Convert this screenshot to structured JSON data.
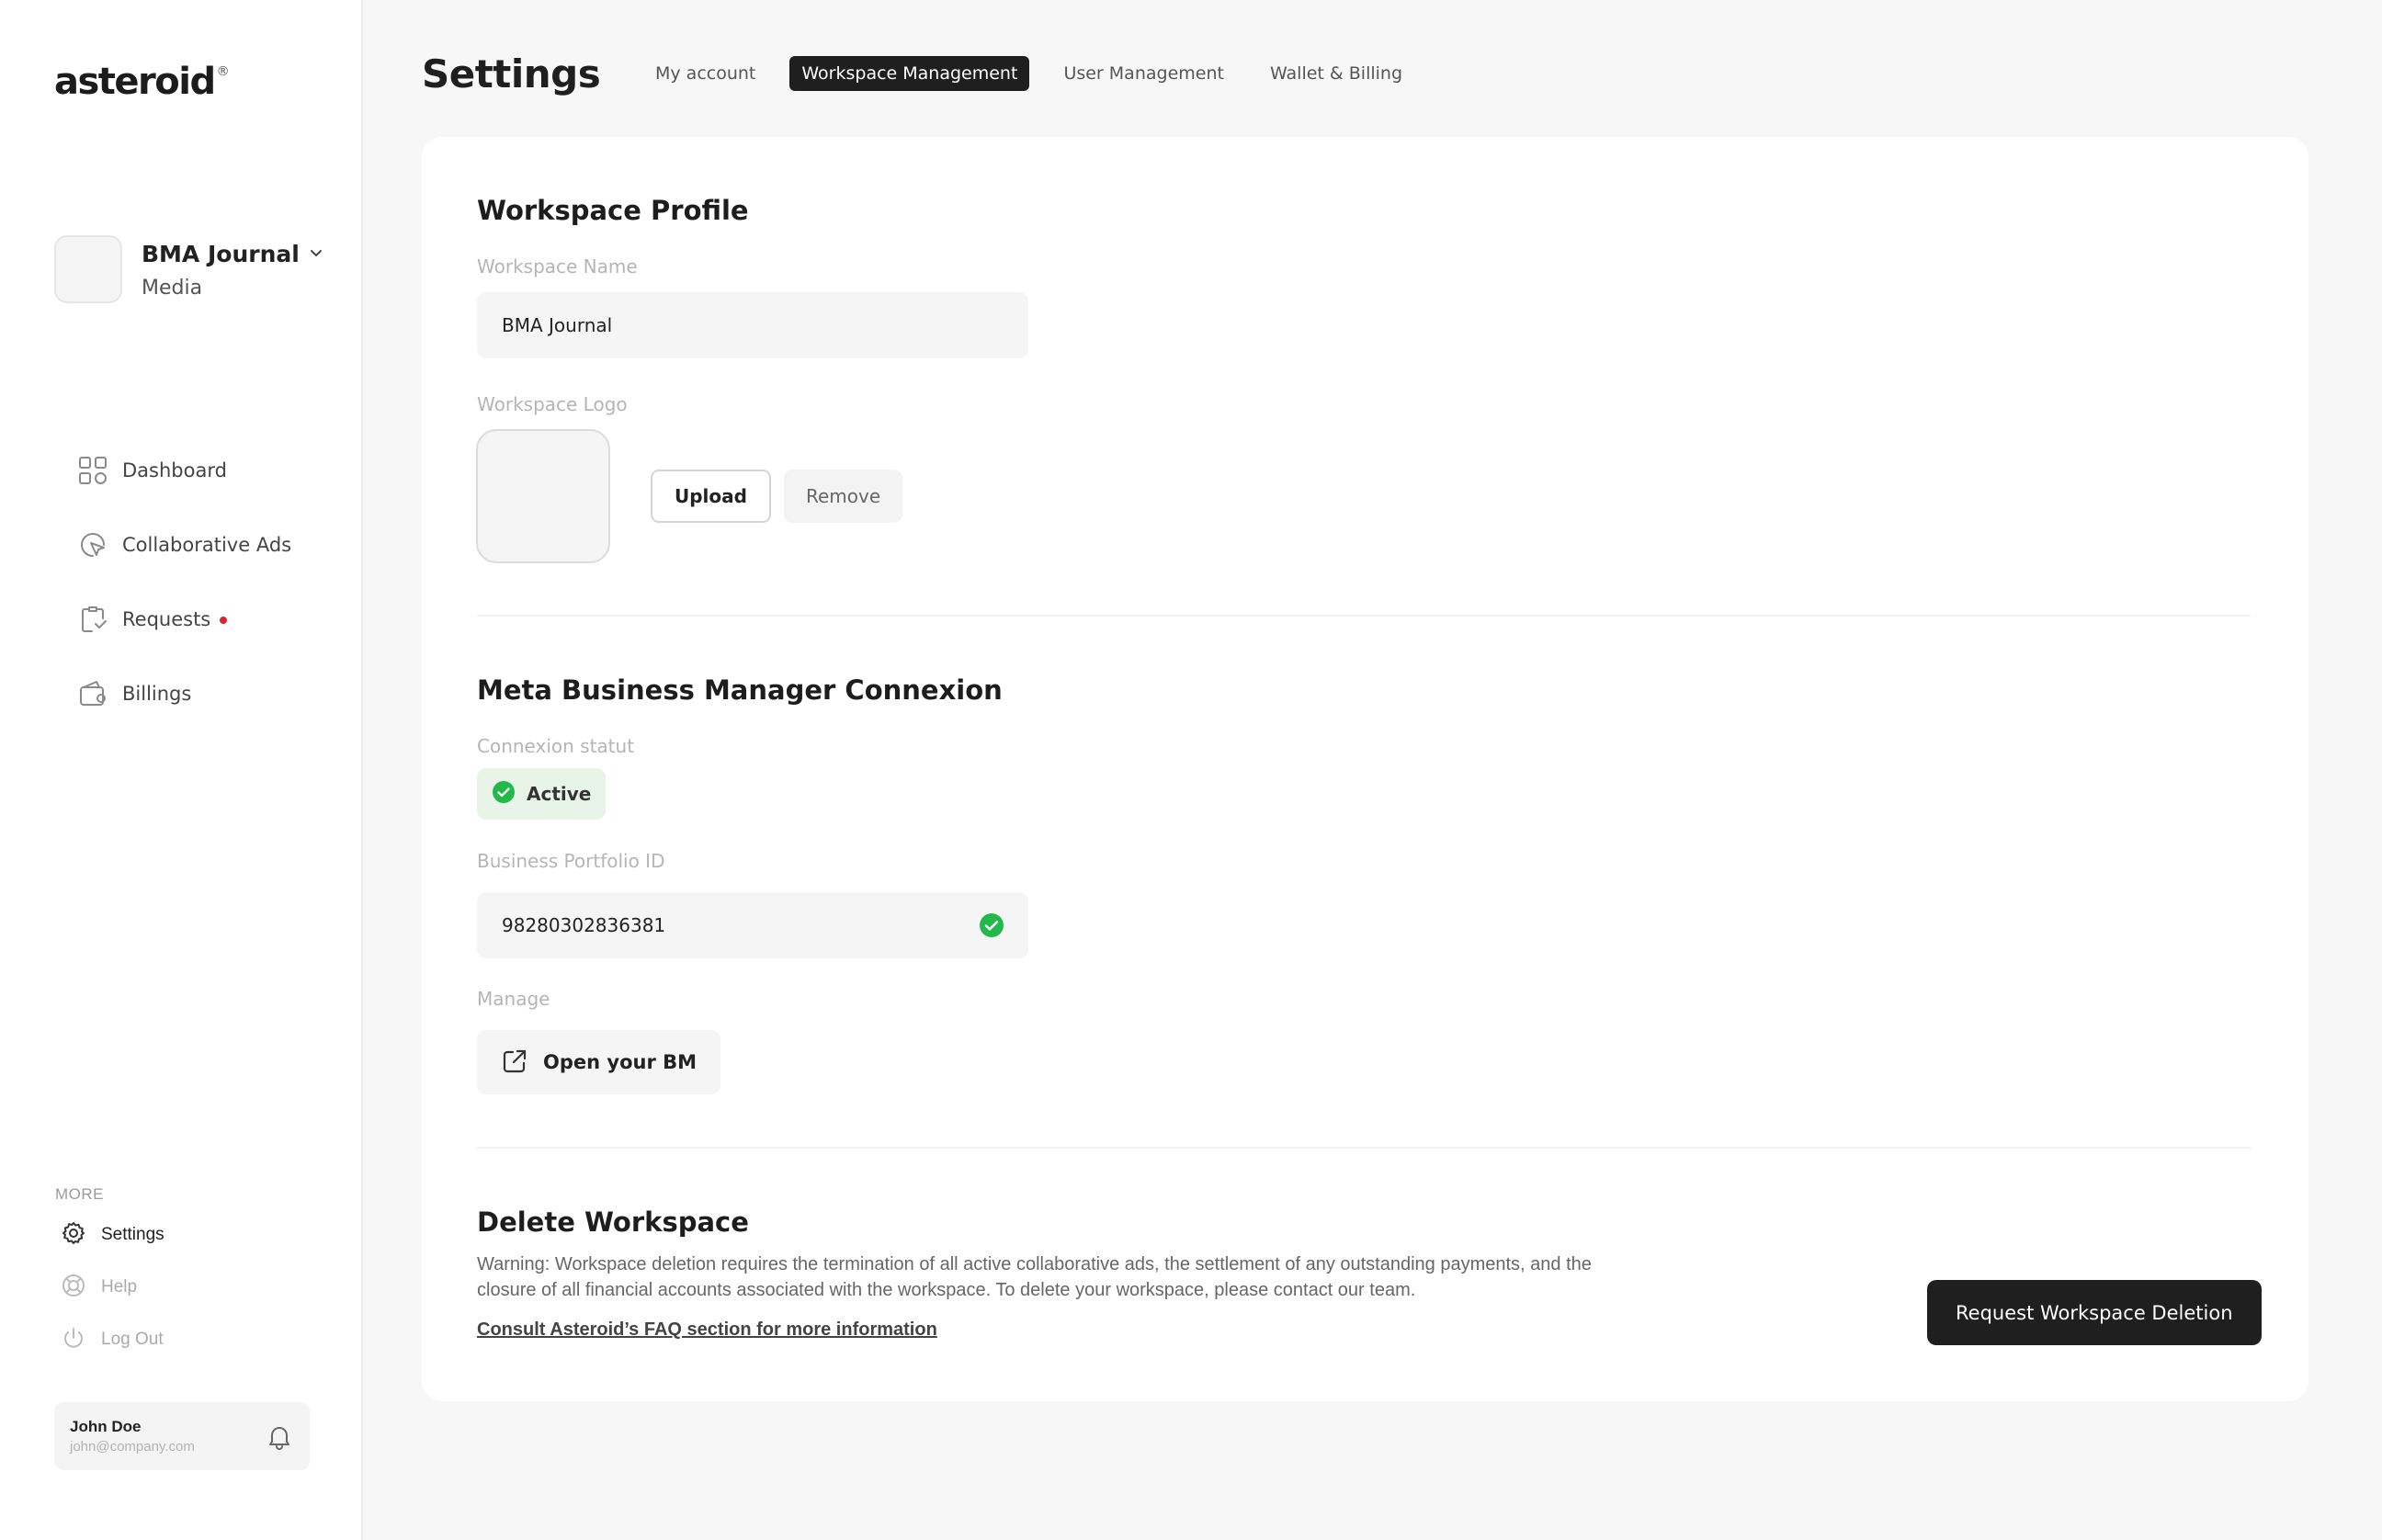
{
  "app": {
    "brand": "asteroid",
    "brand_mark": "®"
  },
  "workspace_switcher": {
    "name": "BMA Journal",
    "type": "Media"
  },
  "nav": {
    "items": [
      {
        "label": "Dashboard",
        "icon": "grid-icon"
      },
      {
        "label": "Collaborative Ads",
        "icon": "pointer-icon"
      },
      {
        "label": "Requests",
        "icon": "requests-icon",
        "has_notification": true
      },
      {
        "label": "Billings",
        "icon": "wallet-icon"
      }
    ]
  },
  "more": {
    "heading": "MORE",
    "items": [
      {
        "label": "Settings",
        "icon": "gear-icon",
        "active": true
      },
      {
        "label": "Help",
        "icon": "lifebuoy-icon",
        "active": false
      },
      {
        "label": "Log Out",
        "icon": "power-icon",
        "active": false
      }
    ]
  },
  "user": {
    "name": "John Doe",
    "email": "john@company.com"
  },
  "header": {
    "title": "Settings",
    "tabs": [
      {
        "label": "My account",
        "active": false
      },
      {
        "label": "Workspace Management",
        "active": true
      },
      {
        "label": "User Management",
        "active": false
      },
      {
        "label": "Wallet & Billing",
        "active": false
      }
    ]
  },
  "profile": {
    "title": "Workspace Profile",
    "name_label": "Workspace Name",
    "name_value": "BMA Journal",
    "logo_label": "Workspace Logo",
    "upload_label": "Upload",
    "remove_label": "Remove"
  },
  "meta": {
    "title": "Meta Business Manager Connexion",
    "status_label": "Connexion statut",
    "status_value": "Active",
    "portfolio_label": "Business Portfolio ID",
    "portfolio_value": "98280302836381",
    "manage_label": "Manage",
    "open_bm_label": "Open your BM"
  },
  "delete": {
    "title": "Delete Workspace",
    "warning": "Warning: Workspace deletion requires the termination of all active collaborative ads, the settlement of any outstanding payments, and the closure of all financial accounts associated with the workspace. To delete your workspace, please contact our team.",
    "faq_link": "Consult Asteroid’s FAQ section for more information",
    "button_label": "Request Workspace Deletion"
  },
  "colors": {
    "accent_dark": "#1f1f1f",
    "success_green": "#22b84a",
    "notification_red": "#e0242b",
    "status_bg": "#e7f4e7"
  }
}
